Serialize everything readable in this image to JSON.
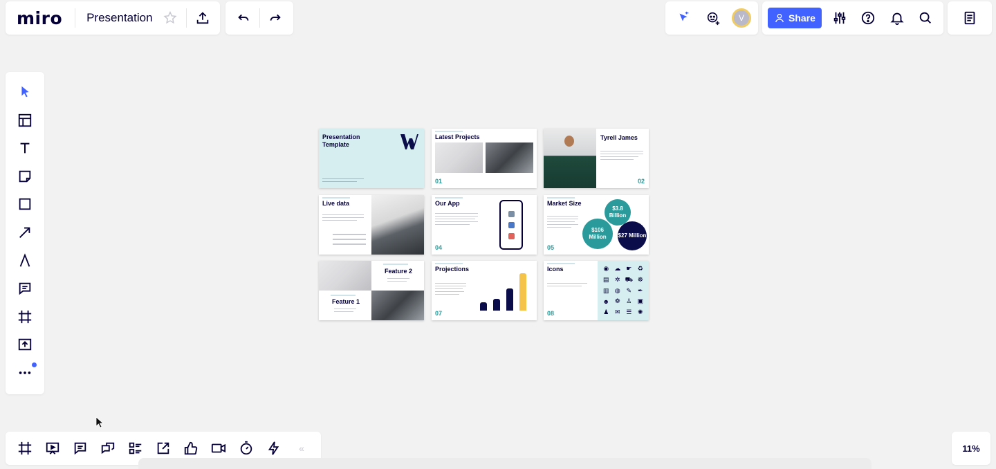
{
  "header": {
    "logo": "miro",
    "board_title": "Presentation"
  },
  "actions": {
    "share_label": "Share"
  },
  "collab": {
    "avatar_initial": "V"
  },
  "zoom": {
    "level": "11%"
  },
  "slides": [
    {
      "title_line1": "Presentation",
      "title_line2": "Template"
    },
    {
      "title": "Latest Projects",
      "number": "01"
    },
    {
      "title": "Tyrell James",
      "number": "02"
    },
    {
      "title": "Live data"
    },
    {
      "title": "Our App",
      "number": "04"
    },
    {
      "title": "Market Size",
      "number": "05",
      "bubbles": [
        "$3.8 Billion",
        "$106 Million",
        "$27 Million"
      ]
    },
    {
      "title_a": "Feature 2",
      "title_b": "Feature 1"
    },
    {
      "title": "Projections",
      "number": "07",
      "bar_fractions": [
        0.18,
        0.26,
        0.48,
        0.82
      ]
    },
    {
      "title": "Icons",
      "number": "08"
    }
  ],
  "colors": {
    "accent": "#4262ff",
    "teal": "#2b9a9b",
    "navy": "#0b0d4a",
    "yellow": "#f5c24a"
  }
}
